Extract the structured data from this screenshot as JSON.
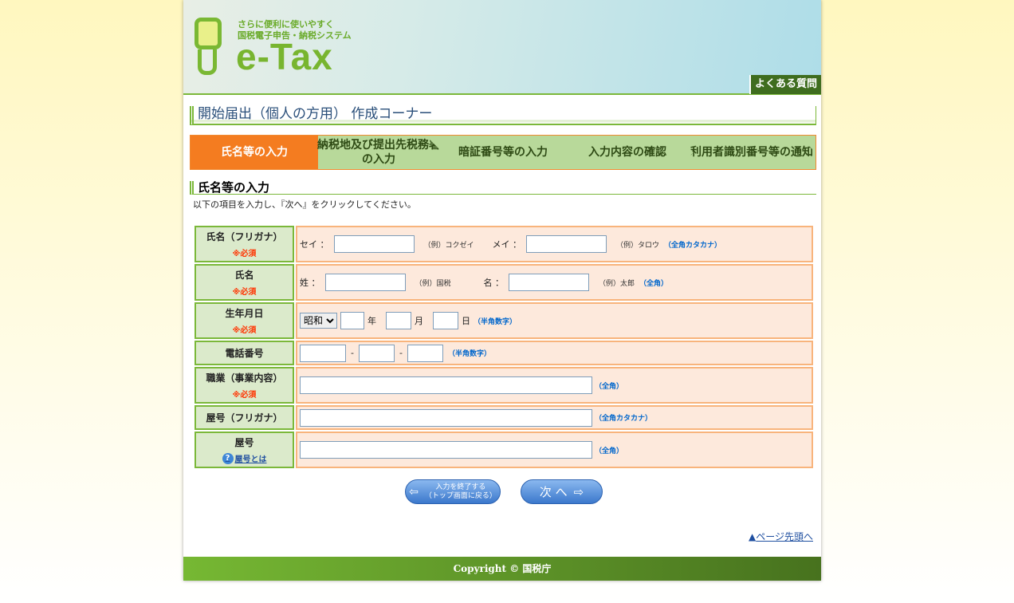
{
  "header": {
    "tagline1": "さらに便利に使いやすく",
    "tagline2": "国税電子申告・納税システム",
    "logo": "e-Tax",
    "faq": "よくある質問"
  },
  "page_title": "開始届出（個人の方用） 作成コーナー",
  "steps": [
    "氏名等の入力",
    "納税地及び提出先税務署の入力",
    "暗証番号等の入力",
    "入力内容の確認",
    "利用者識別番号等の通知"
  ],
  "section_title": "氏名等の入力",
  "instruction": "以下の項目を入力し、『次へ』をクリックしてください。",
  "required": "※必須",
  "rows": {
    "kana": {
      "label": "氏名（フリガナ）",
      "sei": "セイ ：",
      "sei_ex": "（例）コクゼイ",
      "mei": "メイ ：",
      "mei_ex": "（例）タロウ",
      "note": "（全角カタカナ）"
    },
    "name": {
      "label": "氏名",
      "sei": "姓  ：",
      "sei_ex": "（例）国税",
      "mei": "名  ：",
      "mei_ex": "（例）太郎",
      "note": "（全角）"
    },
    "birth": {
      "label": "生年月日",
      "era": "昭和",
      "year": "年",
      "month": "月",
      "day": "日",
      "note": "（半角数字）"
    },
    "phone": {
      "label": "電話番号",
      "dash": "-",
      "note": "（半角数字）"
    },
    "job": {
      "label": "職業（事業内容）",
      "note": "（全角）"
    },
    "trade_kana": {
      "label": "屋号（フリガナ）",
      "note": "（全角カタカナ）"
    },
    "trade": {
      "label": "屋号",
      "help": "屋号とは",
      "note": "（全角）"
    }
  },
  "buttons": {
    "quit_line1": "入力を終了する",
    "quit_line2": "（トップ画面に戻る）",
    "next": "次 へ"
  },
  "top_link": "ページ先頭へ",
  "footer": "Copyright © 国税庁"
}
